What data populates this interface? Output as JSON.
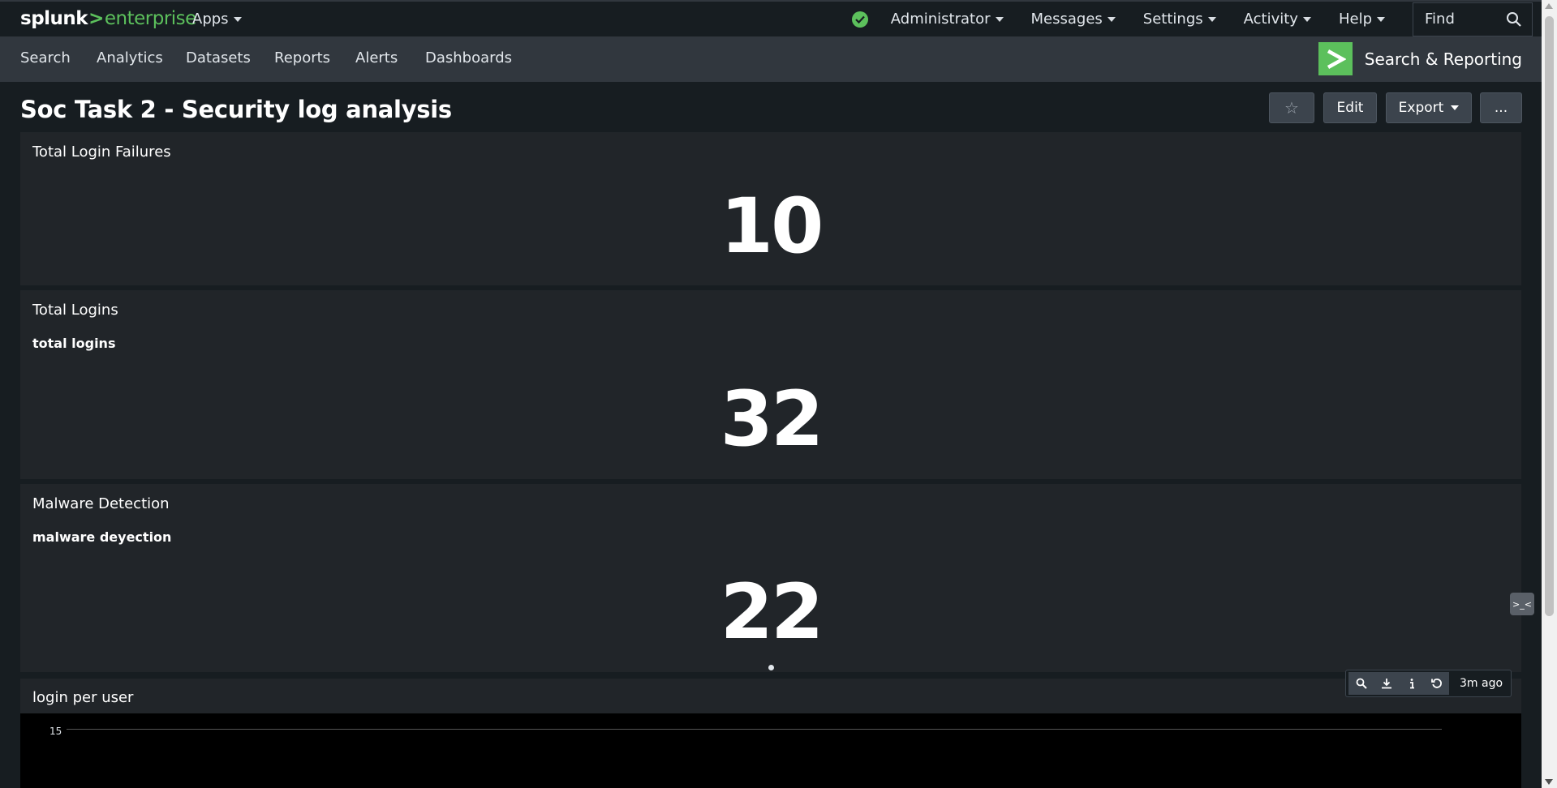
{
  "brand": {
    "splunk": "splunk",
    "gt": ">",
    "enterprise": "enterprise"
  },
  "topbar": {
    "apps_label": "Apps",
    "menu": [
      "Administrator",
      "Messages",
      "Settings",
      "Activity",
      "Help"
    ],
    "find_placeholder": "Find"
  },
  "navbar": {
    "links": [
      "Search",
      "Analytics",
      "Datasets",
      "Reports",
      "Alerts",
      "Dashboards"
    ],
    "app_name": "Search & Reporting"
  },
  "dashboard": {
    "title": "Soc Task 2 - Security log analysis",
    "buttons": {
      "star": "☆",
      "edit": "Edit",
      "export": "Export",
      "more": "..."
    }
  },
  "panels": [
    {
      "title": "Total Login Failures",
      "subtitle": "",
      "value": "10"
    },
    {
      "title": "Total Logins",
      "subtitle": "total logins",
      "value": "32"
    },
    {
      "title": "Malware Detection",
      "subtitle": "malware deyection",
      "value": "22"
    },
    {
      "title": "login per user"
    }
  ],
  "chart": {
    "tick_top": "15"
  },
  "panel_toolbar": {
    "ago": "3m ago"
  },
  "side_tab": ">_<",
  "colors": {
    "accent": "#5cc05c",
    "bg": "#171d21",
    "panel": "#212529",
    "nav": "#31373e"
  }
}
